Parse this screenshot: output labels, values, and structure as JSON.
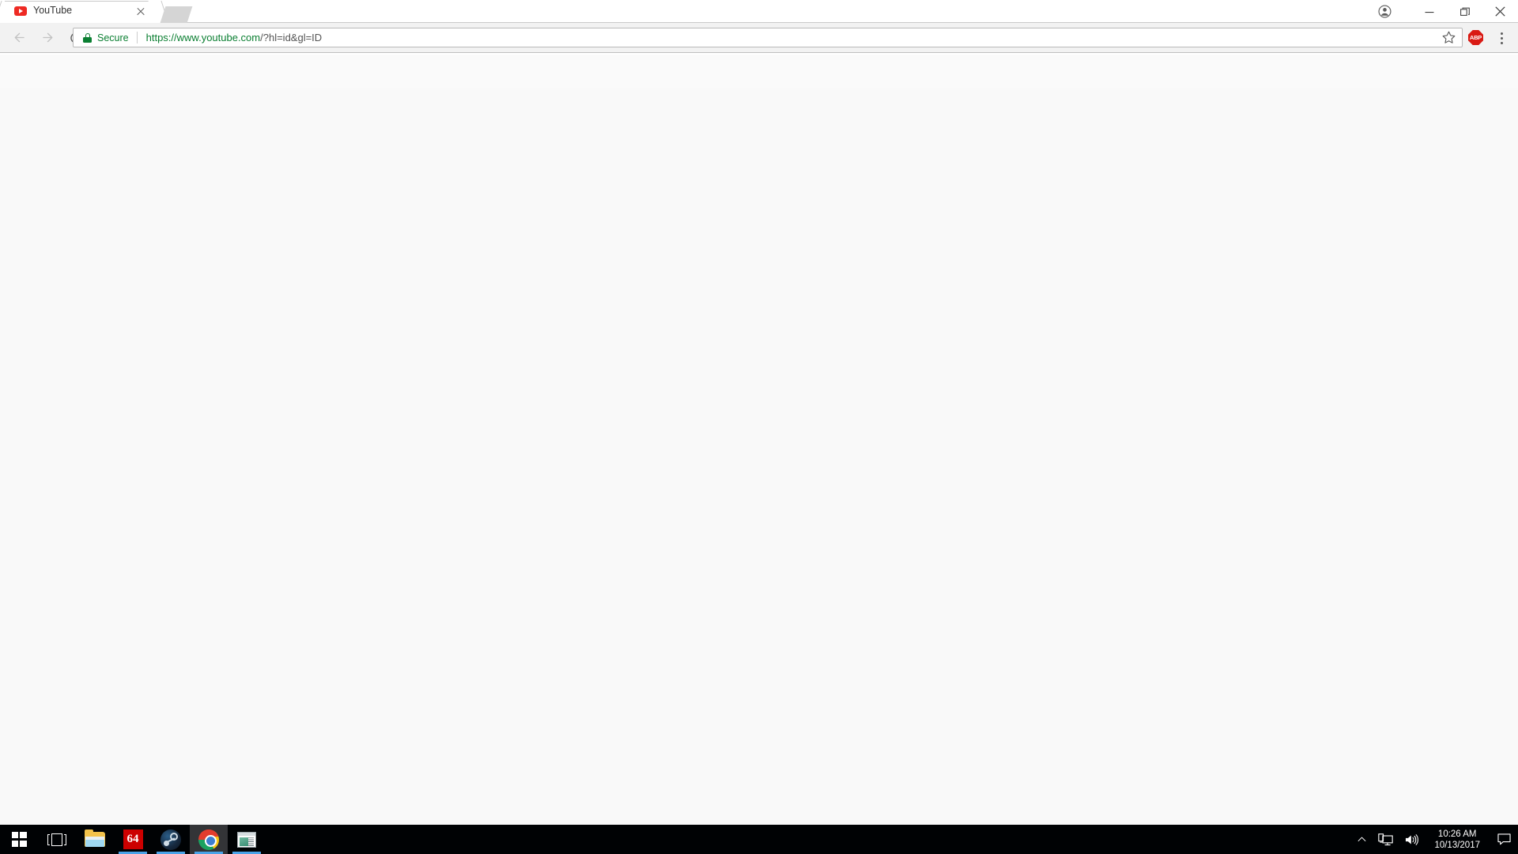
{
  "browser": {
    "name": "Google Chrome",
    "tabs": [
      {
        "title": "YouTube",
        "favicon": "youtube-favicon",
        "active": true,
        "close_label": "×"
      }
    ],
    "new_tab_label": "New Tab",
    "toolbar": {
      "back_label": "Back",
      "forward_label": "Forward",
      "reload_label": "Reload",
      "security_label": "Secure",
      "security_icon": "lock-icon",
      "security_color": "#0b7f32",
      "url_full": "https://www.youtube.com/?hl=id&gl=ID",
      "url_scheme_host": "https://www.youtube.com",
      "url_path": "/?hl=id&gl=ID",
      "bookmark_label": "Bookmark this page",
      "bookmark_icon": "star-icon",
      "extensions": [
        {
          "name": "Adblock Plus",
          "short_label": "ABP",
          "icon": "abp-octagon-icon",
          "color": "#d91a14"
        }
      ],
      "menu_label": "Customize and control Google Chrome",
      "menu_icon": "three-dot-menu-icon"
    },
    "window_controls": {
      "profile_label": "You",
      "profile_icon": "account-circle-icon",
      "minimize_label": "Minimize",
      "maximize_label": "Restore",
      "close_label": "Close"
    }
  },
  "page": {
    "site": "YouTube",
    "masthead_background": "#fafafa",
    "body_background": "#f9f9f9",
    "state": "blank-loading"
  },
  "taskbar": {
    "background": "#000204",
    "items": [
      {
        "name": "start",
        "label": "Start",
        "icon": "windows-logo-icon",
        "running": false,
        "active": false
      },
      {
        "name": "task-view",
        "label": "Task View",
        "icon": "task-view-icon",
        "running": false,
        "active": false
      },
      {
        "name": "file-explorer",
        "label": "File Explorer",
        "icon": "folder-icon",
        "running": false,
        "active": false
      },
      {
        "name": "sixtyfour",
        "label": "64",
        "icon": "sixtyfour-icon",
        "running": true,
        "active": false
      },
      {
        "name": "steam",
        "label": "Steam",
        "icon": "steam-icon",
        "running": true,
        "active": false
      },
      {
        "name": "chrome",
        "label": "Google Chrome",
        "icon": "chrome-icon",
        "running": true,
        "active": true
      },
      {
        "name": "media-app",
        "label": "Window App",
        "icon": "app-window-icon",
        "running": true,
        "active": false
      }
    ],
    "tray": {
      "show_hidden_label": "Show hidden icons",
      "show_hidden_icon": "chevron-up-icon",
      "network_label": "Network",
      "network_icon": "network-monitor-icon",
      "volume_label": "Volume",
      "volume_icon": "speaker-icon",
      "time": "10:26 AM",
      "date": "10/13/2017",
      "action_center_label": "Action Center",
      "action_center_icon": "speech-bubble-icon"
    }
  }
}
